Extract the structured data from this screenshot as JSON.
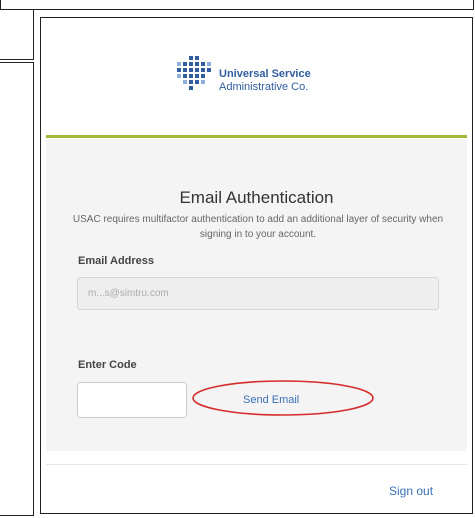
{
  "logo": {
    "line1": "Universal Service",
    "line2": "Administrative Co.",
    "icon": "usac-logo-icon"
  },
  "auth": {
    "title": "Email Authentication",
    "description": "USAC requires multifactor authentication to add an additional layer of security when signing in to your account.",
    "email_label": "Email Address",
    "email_value": "m...s@simtru.com",
    "code_label": "Enter Code",
    "code_value": "",
    "send_email": "Send Email"
  },
  "footer": {
    "sign_out": "Sign out"
  },
  "colors": {
    "accent": "#a2b733",
    "link": "#3a70b7",
    "brand": "#2f5d9e",
    "annotation": "#d62b2b"
  }
}
